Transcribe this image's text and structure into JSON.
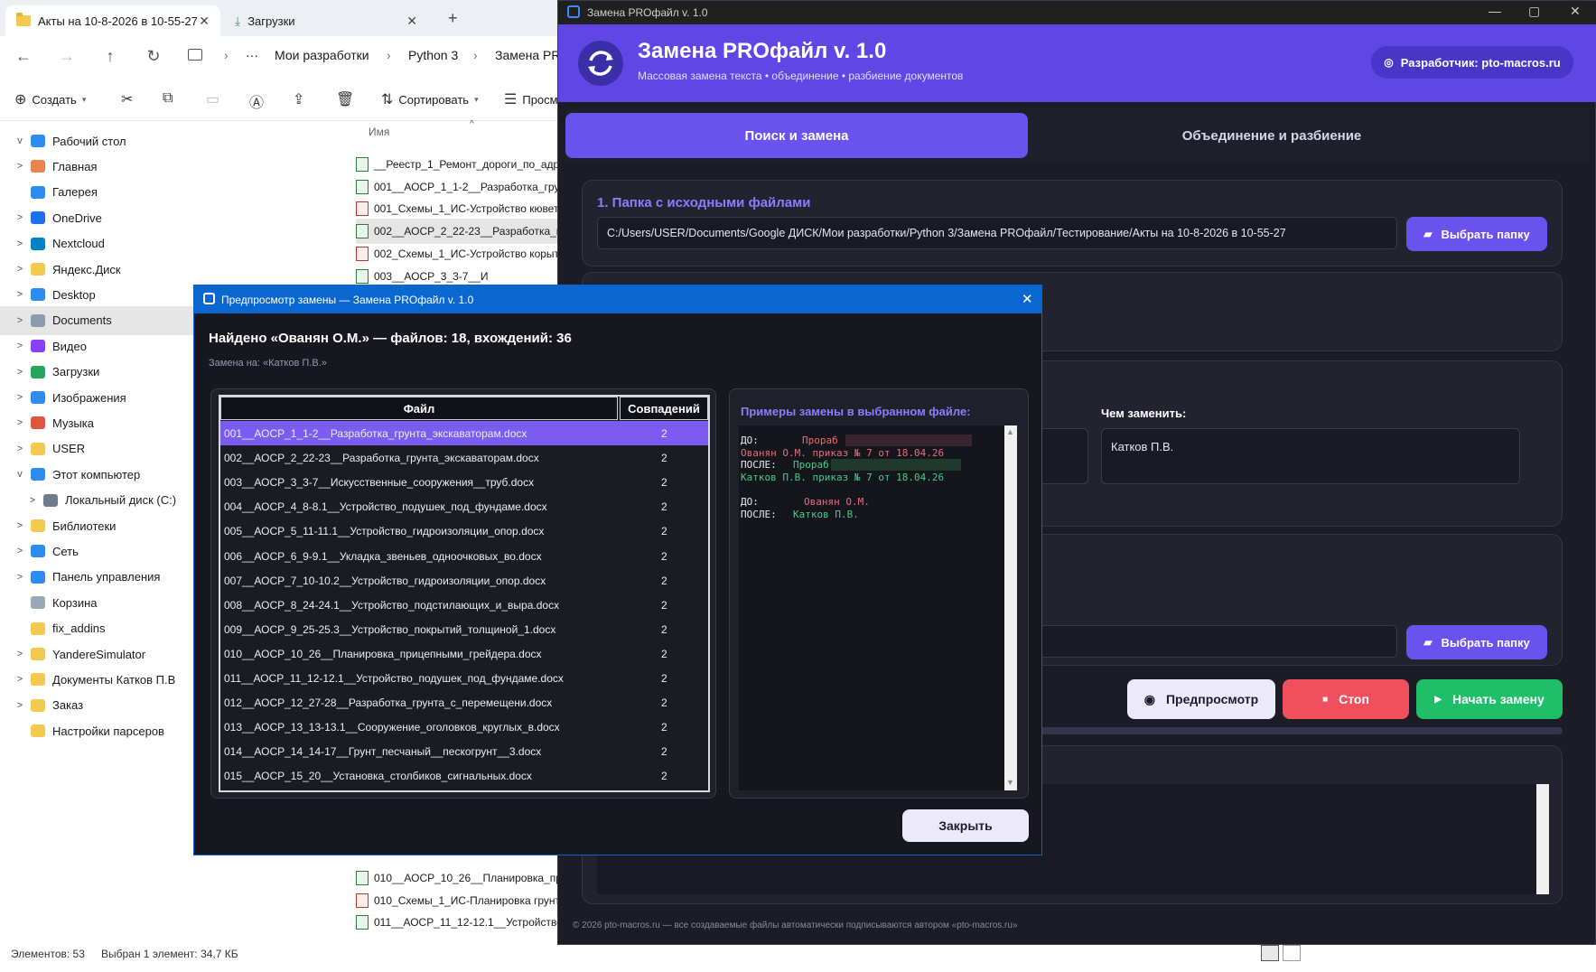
{
  "explorer": {
    "tabs": [
      {
        "label": "Акты на 10-8-2026 в 10-55-27"
      },
      {
        "label": "Загрузки"
      }
    ],
    "breadcrumbs": [
      "Мои разработки",
      "Python 3",
      "Замена PR"
    ],
    "toolbar": {
      "create": "Создать",
      "sort": "Сортировать",
      "view": "Просм"
    },
    "column_name": "Имя",
    "sidebar": [
      {
        "label": "Рабочий стол",
        "expand": "v",
        "color": "#2d8cf0"
      },
      {
        "label": "Главная",
        "expand": ">",
        "color": "#e9834b"
      },
      {
        "label": "Галерея",
        "expand": "",
        "color": "#2d8cf0"
      },
      {
        "label": "OneDrive",
        "expand": ">",
        "color": "#1a73e8"
      },
      {
        "label": "Nextcloud",
        "expand": ">",
        "color": "#0082c9"
      },
      {
        "label": "Яндекс.Диск",
        "expand": ">",
        "color": "#f2c94c"
      },
      {
        "label": "Desktop",
        "expand": ">",
        "color": "#2d8cf0"
      },
      {
        "label": "Documents",
        "expand": ">",
        "color": "#8d9bb0"
      },
      {
        "label": "Видео",
        "expand": ">",
        "color": "#8a3ffc"
      },
      {
        "label": "Загрузки",
        "expand": ">",
        "color": "#27a55a"
      },
      {
        "label": "Изображения",
        "expand": ">",
        "color": "#2d8cf0"
      },
      {
        "label": "Музыка",
        "expand": ">",
        "color": "#e0553d"
      },
      {
        "label": "USER",
        "expand": ">",
        "color": "#f2c94c"
      },
      {
        "label": "Этот компьютер",
        "expand": "v",
        "color": "#2d8cf0"
      },
      {
        "label": "Локальный диск (C:)",
        "expand": ">",
        "color": "#6f7c8e"
      },
      {
        "label": "Библиотеки",
        "expand": ">",
        "color": "#f2c94c"
      },
      {
        "label": "Сеть",
        "expand": ">",
        "color": "#2d8cf0"
      },
      {
        "label": "Панель управления",
        "expand": ">",
        "color": "#2d8cf0"
      },
      {
        "label": "Корзина",
        "expand": "",
        "color": "#9aa7b8"
      },
      {
        "label": "fix_addins",
        "expand": "",
        "color": "#f2c94c"
      },
      {
        "label": "YandereSimulator",
        "expand": ">",
        "color": "#f2c94c"
      },
      {
        "label": "Документы Катков П.В",
        "expand": ">",
        "color": "#f2c94c"
      },
      {
        "label": "Заказ",
        "expand": ">",
        "color": "#f2c94c"
      },
      {
        "label": "Настройки парсеров",
        "expand": "",
        "color": "#f2c94c"
      }
    ],
    "files_top": [
      {
        "name": "__Реестр_1_Ремонт_дороги_по_адре",
        "red": false
      },
      {
        "name": "001__АОСР_1_1-2__Разработка_грунт",
        "red": false
      },
      {
        "name": "001_Схемы_1_ИС-Устройство кювет",
        "red": true
      },
      {
        "name": "002__АОСР_2_22-23__Разработка_гру",
        "red": false
      },
      {
        "name": "002_Схемы_1_ИС-Устройство корыт",
        "red": true
      },
      {
        "name": "003__АОСР_3_3-7__И",
        "red": false
      }
    ],
    "files_bottom": [
      {
        "name": "010__АОСР_10_26__Планировка_при",
        "red": false
      },
      {
        "name": "010_Схемы_1_ИС-Планировка грунт",
        "red": true
      },
      {
        "name": "011__АОСР_11_12-12.1__Устройство_",
        "red": false
      }
    ],
    "status": {
      "count": "Элементов: 53",
      "selected": "Выбран 1 элемент: 34,7 КБ"
    }
  },
  "app": {
    "window_title": "Замена PROфайл v. 1.0",
    "title": "Замена PROфайл v. 1.0",
    "subtitle": "Массовая замена текста  •  объединение  •  разбиение документов",
    "developer": "Разработчик: pto-macros.ru",
    "tabs": [
      "Поиск и замена",
      "Объединение и разбиение"
    ],
    "section1_title": "1.  Папка с исходными файлами",
    "source_path": "C:/Users/USER/Documents/Google ДИСК/Мои разработки/Python 3/Замена PROфайл/Тестирование/Акты на 10-8-2026 в 10-55-27",
    "choose_folder": "Выбрать папку",
    "replace_with_label": "Чем заменить:",
    "replace_with_value": "Катков П.В.",
    "btn_preview": "Предпросмотр",
    "btn_stop": "Стоп",
    "btn_start": "Начать замену",
    "footer": "© 2026 pto-macros.ru — все создаваемые файлы автоматически подписываются автором «pto-macros.ru»",
    "colors": {
      "accent": "#6a52ee",
      "stop": "#f0505e",
      "start": "#1fbf6a"
    }
  },
  "dialog": {
    "title": "Предпросмотр замены — Замена PROфайл v. 1.0",
    "heading": "Найдено «Ованян О.М.»  —  файлов: 18,  вхождений: 36",
    "subheading": "Замена на: «Катков П.В.»",
    "col_file": "Файл",
    "col_matches": "Совпадений",
    "rows": [
      {
        "file": "001__АОСР_1_1-2__Разработка_грунта_экскаваторам.docx",
        "count": "2"
      },
      {
        "file": "002__АОСР_2_22-23__Разработка_грунта_экскаваторам.docx",
        "count": "2"
      },
      {
        "file": "003__АОСР_3_3-7__Искусственные_сооружения__труб.docx",
        "count": "2"
      },
      {
        "file": "004__АОСР_4_8-8.1__Устройство_подушек_под_фундаме.docx",
        "count": "2"
      },
      {
        "file": "005__АОСР_5_11-11.1__Устройство_гидроизоляции_опор.docx",
        "count": "2"
      },
      {
        "file": "006__АОСР_6_9-9.1__Укладка_звеньев_одноочковых_во.docx",
        "count": "2"
      },
      {
        "file": "007__АОСР_7_10-10.2__Устройство_гидроизоляции_опор.docx",
        "count": "2"
      },
      {
        "file": "008__АОСР_8_24-24.1__Устройство_подстилающих_и_выра.docx",
        "count": "2"
      },
      {
        "file": "009__АОСР_9_25-25.3__Устройство_покрытий_толщиной_1.docx",
        "count": "2"
      },
      {
        "file": "010__АОСР_10_26__Планировка_прицепными_грейдера.docx",
        "count": "2"
      },
      {
        "file": "011__АОСР_11_12-12.1__Устройство_подушек_под_фундаме.docx",
        "count": "2"
      },
      {
        "file": "012__АОСР_12_27-28__Разработка_грунта_с_перемещени.docx",
        "count": "2"
      },
      {
        "file": "013__АОСР_13_13-13.1__Сооружение_оголовков_круглых_в.docx",
        "count": "2"
      },
      {
        "file": "014__АОСР_14_14-17__Грунт_песчаный__пескогрунт__3.docx",
        "count": "2"
      },
      {
        "file": "015__АОСР_15_20__Установка_столбиков_сигнальных.docx",
        "count": "2"
      }
    ],
    "examples_title": "Примеры замены в выбранном файле:",
    "examples": [
      {
        "before_label": "ДО:",
        "before_text": "Прораб",
        "before_line2": "Ованян О.М. приказ № 7 от 18.04.26",
        "after_label": "ПОСЛЕ:",
        "after_text": "Прораб",
        "after_line2": "Катков П.В. приказ № 7 от 18.04.26"
      },
      {
        "before_label": "ДО:",
        "before_text": "Ованян О.М.",
        "after_label": "ПОСЛЕ:",
        "after_text": "Катков П.В."
      }
    ],
    "close": "Закрыть"
  }
}
